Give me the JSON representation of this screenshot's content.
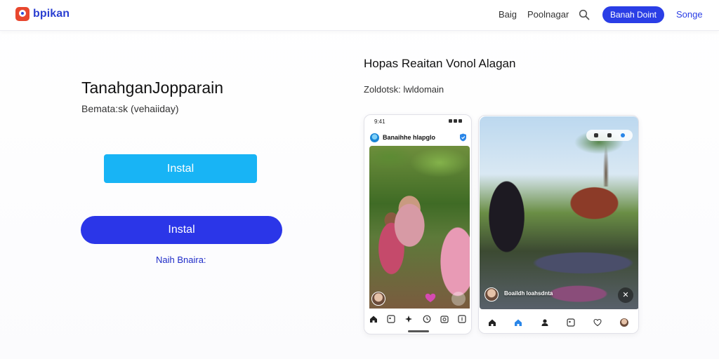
{
  "header": {
    "logo_text": "bpikan",
    "nav": [
      "Baig",
      "Poolnagar"
    ],
    "cta_label": "Banah Doint",
    "last_link": "Songe"
  },
  "hero": {
    "title": "TanahganJopparain",
    "subtitle": "Bemata:sk (vehaiiday)",
    "install_primary": "Instal",
    "install_secondary": "Instal",
    "link": "Naih Bnaira:"
  },
  "showcase": {
    "title": "Hopas Reaitan Vonol Alagan",
    "subtitle": "Zoldotsk: lwldomain",
    "phone_a": {
      "status_time": "9:41",
      "app_name": "Banaihhe hlapglo"
    },
    "phone_b": {
      "overlay_text": "Boaildh loahsdnta"
    }
  },
  "icons": {
    "search": "search-icon",
    "shield": "shield-icon",
    "heart": "heart-icon",
    "home": "home-icon"
  },
  "colors": {
    "brand_blue": "#2a3ee6",
    "cyan": "#18b4f5",
    "logo_red": "#e8472e"
  }
}
